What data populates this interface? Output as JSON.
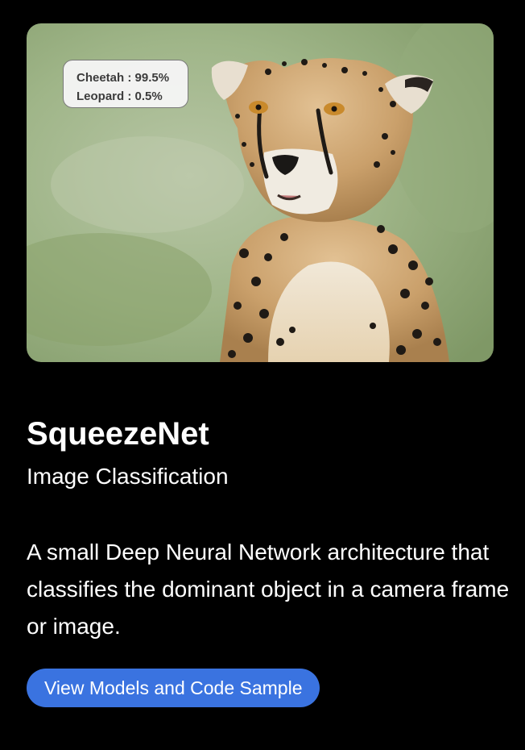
{
  "model": {
    "name": "SqueezeNet",
    "category": "Image Classification",
    "description": "A small Deep Neural Network architecture that classifies the dominant object in a camera frame or image."
  },
  "preview": {
    "predictions": [
      {
        "text": "Cheetah : 99.5%"
      },
      {
        "text": "Leopard : 0.5%"
      }
    ]
  },
  "actions": {
    "view_label": "View Models and Code Sample"
  },
  "colors": {
    "background": "#000000",
    "accent": "#3a73e0",
    "text": "#ffffff"
  }
}
